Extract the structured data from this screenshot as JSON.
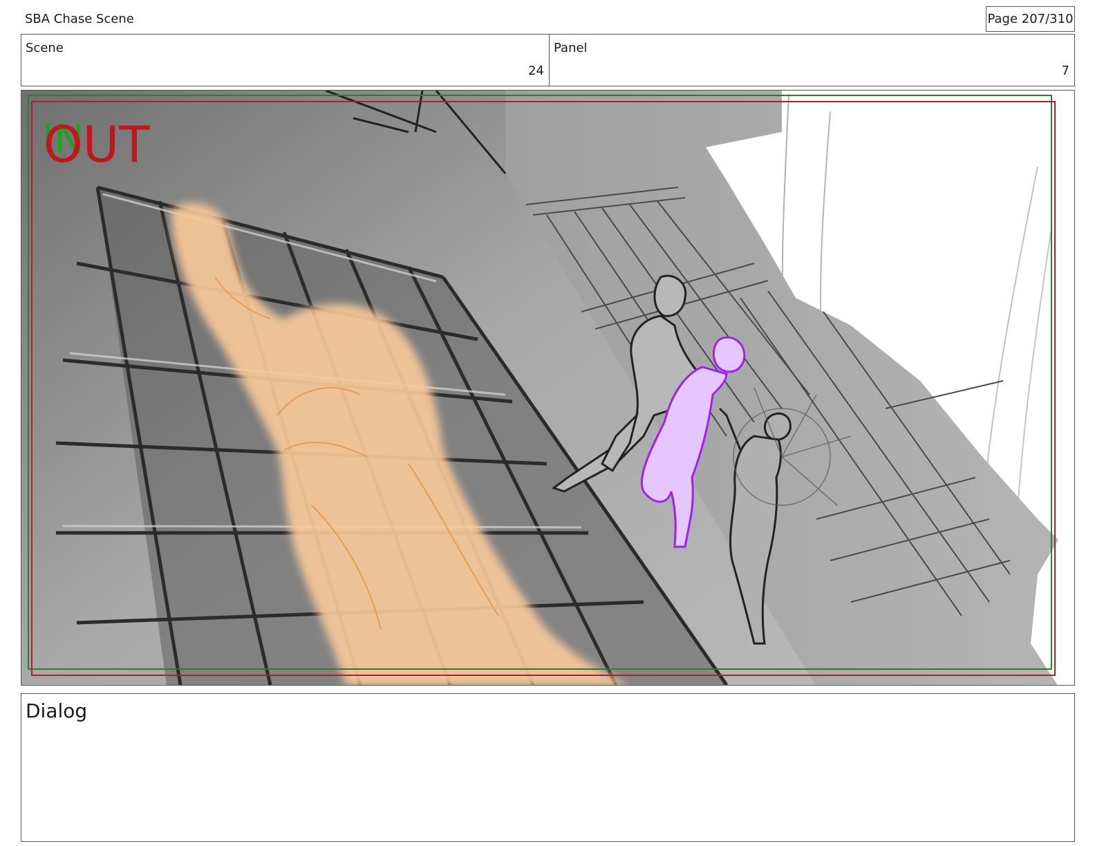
{
  "header": {
    "document_title": "SBA Chase Scene",
    "page_indicator": "Page 207/310"
  },
  "scene": {
    "label": "Scene",
    "value": "24"
  },
  "panel": {
    "label": "Panel",
    "value": "7"
  },
  "artwork": {
    "overlay_in_text": "IN",
    "overlay_out_text": "OUT",
    "colors": {
      "in_marker": "#1fa31f",
      "out_marker": "#c0161c",
      "safe_frame_green": "#2f7a2f",
      "safe_frame_red": "#b0202a",
      "foreground_figure": "#f7c79a",
      "highlight_character": "#a020f0",
      "building": "#9a9a9a"
    }
  },
  "dialog": {
    "label": "Dialog"
  }
}
